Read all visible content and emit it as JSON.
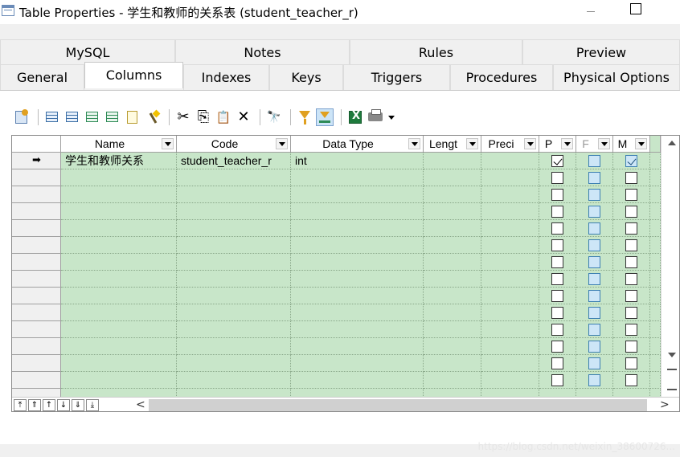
{
  "window": {
    "title": "Table Properties - 学生和教师的关系表 (student_teacher_r)"
  },
  "tabs": {
    "back_row": [
      {
        "label": "MySQL"
      },
      {
        "label": "Notes"
      },
      {
        "label": "Rules"
      },
      {
        "label": "Preview"
      }
    ],
    "front_row": [
      {
        "label": "General"
      },
      {
        "label": "Columns"
      },
      {
        "label": "Indexes"
      },
      {
        "label": "Keys"
      },
      {
        "label": "Triggers"
      },
      {
        "label": "Procedures"
      },
      {
        "label": "Physical Options"
      }
    ],
    "active": "Columns"
  },
  "toolbar": {
    "icons": [
      "properties-icon",
      "add-row-icon",
      "insert-row-icon",
      "add-columns-icon",
      "paste-rows-icon",
      "note-icon",
      "wizard-icon",
      "cut-icon",
      "copy-icon",
      "paste-icon",
      "delete-icon",
      "find-icon",
      "filter-icon",
      "filter-active-icon",
      "excel-export-icon",
      "print-icon",
      "dropdown-icon"
    ],
    "cut_glyph": "✂",
    "copy_glyph": "⎘",
    "paste_glyph": "📋",
    "delete_glyph": "✕",
    "find_glyph": "🔭"
  },
  "grid": {
    "columns": [
      {
        "label": "Name"
      },
      {
        "label": "Code"
      },
      {
        "label": "Data Type"
      },
      {
        "label": "Lengt"
      },
      {
        "label": "Preci"
      },
      {
        "label": "P"
      },
      {
        "label": "F"
      },
      {
        "label": "M"
      }
    ],
    "current_row_marker": "➡",
    "rows": [
      {
        "name": "学生和教师关系",
        "code": "student_teacher_r",
        "data_type": "int",
        "length": "",
        "precision": "",
        "p": true,
        "f": false,
        "m": true
      }
    ],
    "empty_row_count": 14
  },
  "navigation": {
    "buttons": [
      "⤒",
      "⇑",
      "↑",
      "↓",
      "⇓",
      "⤓"
    ],
    "scroll_left": "<",
    "scroll_right": ">"
  },
  "watermark": "https://blog.csdn.net/weixin_38600726..."
}
